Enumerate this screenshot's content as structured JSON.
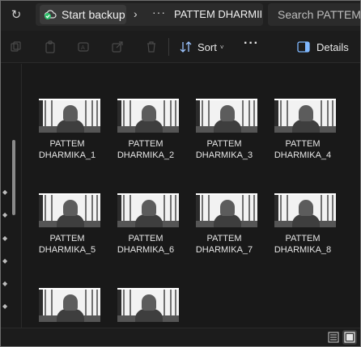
{
  "address_bar": {
    "backup_label": "Start backup",
    "ellipsis": "···",
    "folder": "PATTEM DHARMIKA",
    "search_placeholder": "Search PATTEM DHARMIKA"
  },
  "toolbar": {
    "sort_label": "Sort",
    "more_label": "···",
    "details_label": "Details"
  },
  "files": [
    {
      "line1": "PATTEM",
      "line2": "DHARMIKA_1"
    },
    {
      "line1": "PATTEM",
      "line2": "DHARMIKA_2"
    },
    {
      "line1": "PATTEM",
      "line2": "DHARMIKA_3"
    },
    {
      "line1": "PATTEM",
      "line2": "DHARMIKA_4"
    },
    {
      "line1": "PATTEM",
      "line2": "DHARMIKA_5"
    },
    {
      "line1": "PATTEM",
      "line2": "DHARMIKA_6"
    },
    {
      "line1": "PATTEM",
      "line2": "DHARMIKA_7"
    },
    {
      "line1": "PATTEM",
      "line2": "DHARMIKA_8"
    },
    {
      "line1": "",
      "line2": ""
    },
    {
      "line1": "",
      "line2": ""
    }
  ],
  "colors": {
    "accent_backup": "#2dbf6a",
    "details_icon": "#7fb8ff"
  },
  "icons": {
    "refresh": "refresh-icon",
    "backup": "cloud-backup-icon",
    "sort": "sort-icon",
    "details": "details-pane-icon",
    "view_list": "list-view-icon",
    "view_tiles": "tiles-view-icon"
  }
}
